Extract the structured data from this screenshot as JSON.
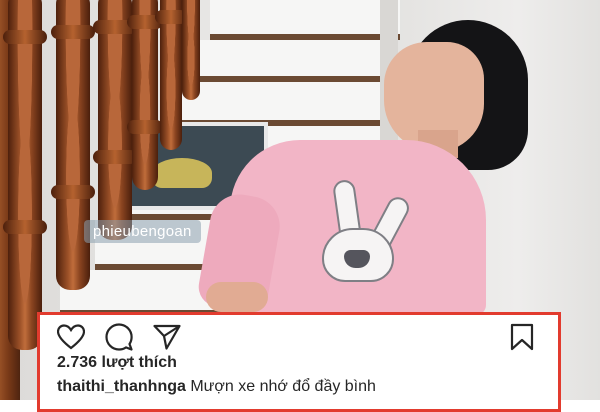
{
  "post": {
    "image_watermark": "phieubengoan",
    "likes_text": "2.736 lượt thích",
    "username": "thaithi_thanhnga",
    "caption": "Mượn xe nhớ đổ đầy bình"
  },
  "icons": {
    "like": "heart-outline-icon",
    "comment": "comment-bubble-icon",
    "share": "paper-plane-icon",
    "save": "bookmark-outline-icon"
  },
  "colors": {
    "highlight_border": "#e23b2e",
    "text": "#262626",
    "shirt": "#f2b5c6",
    "banister": "#8a4420"
  }
}
